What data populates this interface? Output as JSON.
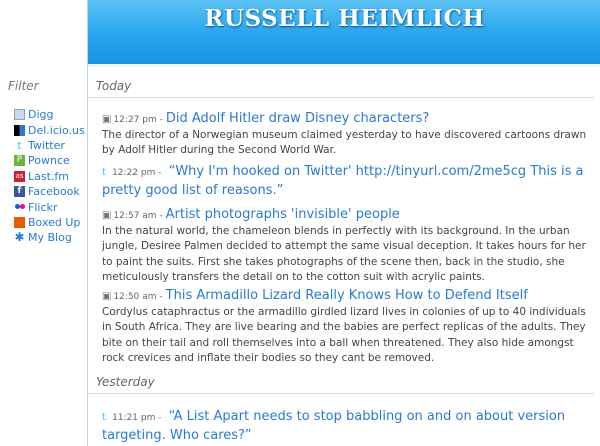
{
  "sidebar": {
    "filter_title": "Filter",
    "items": [
      {
        "label": "Digg",
        "icon": "digg-icon"
      },
      {
        "label": "Del.icio.us",
        "icon": "delicious-icon"
      },
      {
        "label": "Twitter",
        "icon": "twitter-icon"
      },
      {
        "label": "Pownce",
        "icon": "pownce-icon"
      },
      {
        "label": "Last.fm",
        "icon": "lastfm-icon"
      },
      {
        "label": "Facebook",
        "icon": "facebook-icon"
      },
      {
        "label": "Flickr",
        "icon": "flickr-icon"
      },
      {
        "label": "Boxed Up",
        "icon": "boxedup-icon"
      },
      {
        "label": "My Blog",
        "icon": "blog-icon"
      }
    ]
  },
  "header": {
    "title": "RUSSELL HEIMLICH"
  },
  "colors": {
    "header": "#27a4ee",
    "link": "#2a7ad1",
    "text": "#444444"
  },
  "sections": [
    {
      "day": "Today",
      "entries": [
        {
          "icon": "digg-icon",
          "time": "12:27 pm -",
          "title": "Did Adolf Hitler draw Disney characters?",
          "body": "The director of a Norwegian museum claimed yesterday to have discovered cartoons drawn by Adolf Hitler during the Second World War."
        },
        {
          "icon": "twitter-icon",
          "time": "12:22 pm -",
          "title": "“Why I'm hooked on Twitter' http://tinyurl.com/2me5cg This is a pretty good list of reasons.”",
          "body": ""
        },
        {
          "icon": "digg-icon",
          "time": "12:57 am -",
          "title": "Artist photographs 'invisible' people",
          "body": "In the natural world, the chameleon blends in perfectly with its background. In the urban jungle, Desiree Palmen decided to attempt the same visual deception. It takes hours for her to paint the suits. First she takes photographs of the scene then, back in the studio, she meticulously transfers the detail on to the cotton suit with acrylic paints."
        },
        {
          "icon": "digg-icon",
          "time": "12:50 am -",
          "title": "This Armadillo Lizard Really Knows How to Defend Itself",
          "body": "Cordylus cataphractus or the armadillo girdled lizard lives in colonies of up to 40 individuals in South Africa. They are live bearing and the babies are perfect replicas of the adults. They bite on their tail and roll themselves into a ball when threatened. They also hide amongst rock crevices and inflate their bodies so they cant be removed."
        }
      ]
    },
    {
      "day": "Yesterday",
      "entries": [
        {
          "icon": "twitter-icon",
          "time": "11:21 pm -",
          "title": "“A List Apart needs to stop babbling on and on about version targeting. Who cares?”",
          "body": ""
        }
      ]
    }
  ]
}
